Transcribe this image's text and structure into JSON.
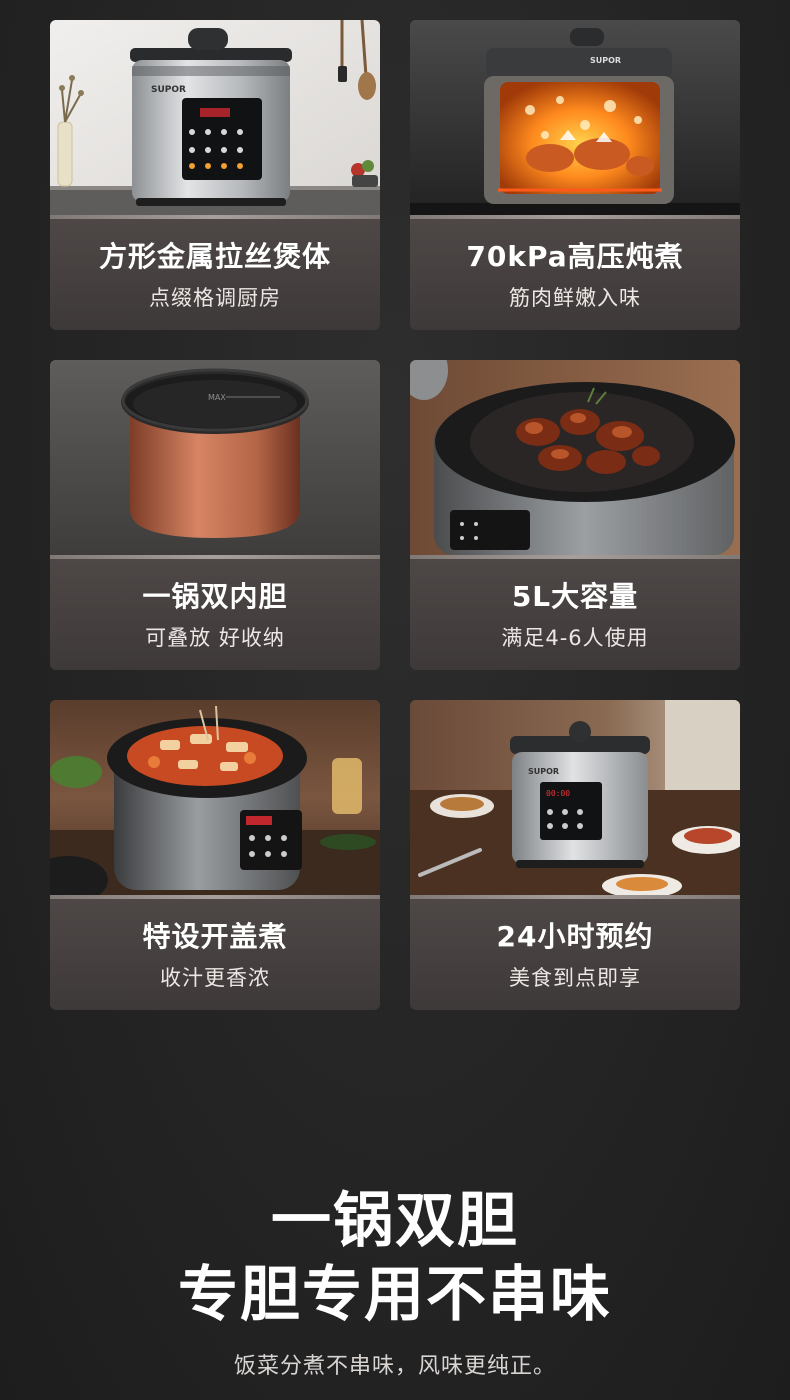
{
  "features": [
    {
      "title": "方形金属拉丝煲体",
      "subtitle": "点缀格调厨房",
      "image": "kitchen-cooker-photo"
    },
    {
      "title": "70kPa高压炖煮",
      "subtitle": "筋肉鲜嫩入味",
      "image": "pressure-cooking-photo"
    },
    {
      "title": "一锅双内胆",
      "subtitle": "可叠放 好收纳",
      "image": "inner-pot-photo"
    },
    {
      "title": "5L大容量",
      "subtitle": "满足4-6人使用",
      "image": "braised-meat-photo"
    },
    {
      "title": "特设开盖煮",
      "subtitle": "收汁更香浓",
      "image": "open-lid-hotpot-photo"
    },
    {
      "title": "24小时预约",
      "subtitle": "美食到点即享",
      "image": "dining-table-photo"
    }
  ],
  "brand": "SUPOR",
  "max_mark": "MAX",
  "display_time": "00:00",
  "headline": {
    "line1": "一锅双胆",
    "line2": "专胆专用不串味"
  },
  "footer": "饭菜分煮不串味，风味更纯正。",
  "colors": {
    "background": "#262626",
    "card_panel": "#5a5352",
    "inner_pot": "#b9694a",
    "heat_glow": "#ff7a1a"
  }
}
